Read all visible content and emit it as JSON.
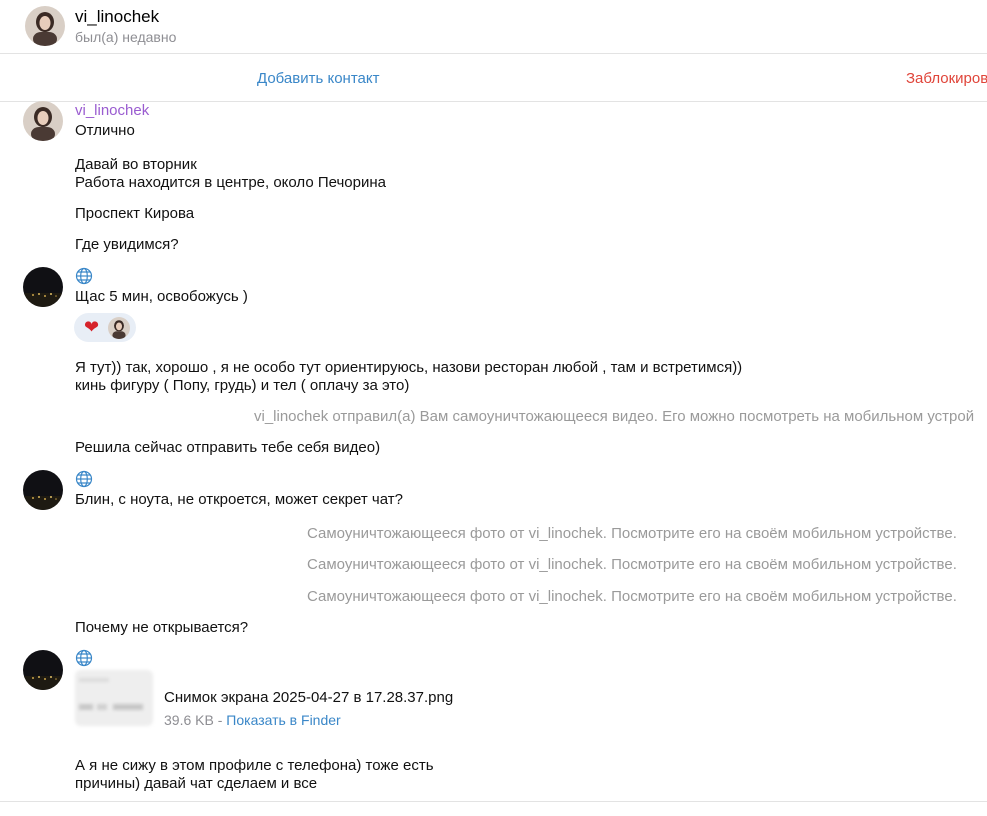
{
  "header": {
    "name": "vi_linochek",
    "status": "был(а) недавно"
  },
  "actions": {
    "add_contact": "Добавить контакт",
    "block": "Заблокиров"
  },
  "messages": {
    "sender_name": "vi_linochek",
    "m1": "Отлично",
    "m2a": "Давай во вторник",
    "m2b": "Работа находится в центре, около Печорина",
    "m3": "Проспект Кирова",
    "m4": "Где увидимся?",
    "m5": "Щас 5 мин, освобожусь )",
    "m6a": "Я тут)) так, хорошо , я не особо тут ориентируюсь, назови ресторан любой , там и встретимся))",
    "m6b": "кинь фигуру ( Попу, грудь) и тел ( оплачу за это)",
    "service_video": "vi_linochek отправил(а) Вам самоуничтожающееся видео. Его можно посмотреть на мобильном устрой",
    "m7": "Решила сейчас отправить тебе себя видео)",
    "m8": "Блин, с ноута, не откроется, может секрет чат?",
    "service_photo1": "Самоуничтожающееся фото от vi_linochek. Посмотрите его на своём мобильном устройстве.",
    "service_photo2": "Самоуничтожающееся фото от vi_linochek. Посмотрите его на своём мобильном устройстве.",
    "service_photo3": "Самоуничтожающееся фото от vi_linochek. Посмотрите его на своём мобильном устройстве.",
    "m9": "Почему не открывается?",
    "m10a": "А я не сижу в этом профиле с телефона) тоже есть",
    "m10b": "причины) давай чат сделаем и все"
  },
  "reaction": {
    "emoji": "❤",
    "icon": "heart-icon"
  },
  "file": {
    "name": "Снимок экрана 2025-04-27 в 17.28.37.png",
    "size": "39.6 KB",
    "separator": " - ",
    "show_in_finder": "Показать в Finder"
  },
  "colors": {
    "link_blue": "#3a87c8",
    "block_red": "#e0453a",
    "sender_purple": "#9a5cd0",
    "service_gray": "#9a9a9a"
  }
}
